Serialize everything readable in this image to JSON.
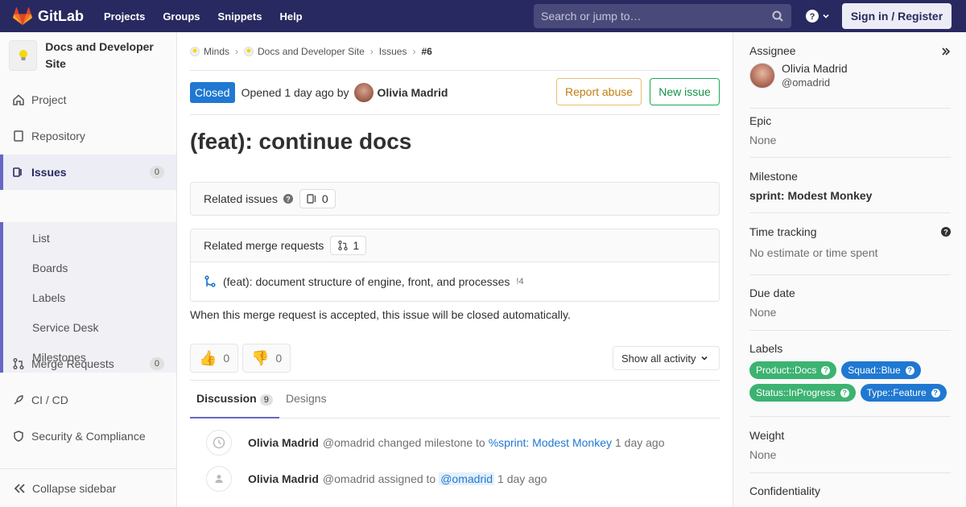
{
  "topbar": {
    "brand": "GitLab",
    "nav": [
      "Projects",
      "Groups",
      "Snippets",
      "Help"
    ],
    "search_placeholder": "Search or jump to…",
    "sign_in": "Sign in / Register"
  },
  "sidebar": {
    "project_name": "Docs and Developer Site",
    "items": [
      {
        "label": "Project",
        "icon": "home-icon"
      },
      {
        "label": "Repository",
        "icon": "document-icon"
      },
      {
        "label": "Issues",
        "icon": "issues-icon",
        "count": "0"
      },
      {
        "label": "Merge Requests",
        "icon": "merge-request-icon",
        "count": "0"
      },
      {
        "label": "CI / CD",
        "icon": "rocket-icon"
      },
      {
        "label": "Security & Compliance",
        "icon": "shield-icon"
      }
    ],
    "sub_items": [
      "List",
      "Boards",
      "Labels",
      "Service Desk",
      "Milestones"
    ],
    "collapse": "Collapse sidebar"
  },
  "breadcrumb": [
    "Minds",
    "Docs and Developer Site",
    "Issues",
    "#6"
  ],
  "issue": {
    "status": "Closed",
    "opened_prefix": "Opened",
    "opened_time": "1 day ago",
    "by": "by",
    "author": "Olivia Madrid",
    "report_abuse": "Report abuse",
    "new_issue": "New issue",
    "title": "(feat): continue docs",
    "related_issues_label": "Related issues",
    "related_issues_count": "0",
    "related_mr_label": "Related merge requests",
    "related_mr_count": "1",
    "mr_title": "(feat): document structure of engine, front, and processes",
    "mr_ref": "!4",
    "close_note": "When this merge request is accepted, this issue will be closed automatically.",
    "thumbs_up": "0",
    "thumbs_down": "0",
    "show_activity": "Show all activity",
    "tabs": {
      "discussion": "Discussion",
      "discussion_count": "9",
      "designs": "Designs"
    }
  },
  "activity": [
    {
      "name": "Olivia Madrid",
      "handle": "@omadrid",
      "action": "changed milestone to",
      "target": "%sprint: Modest Monkey",
      "time": "1 day ago"
    },
    {
      "name": "Olivia Madrid",
      "handle": "@omadrid",
      "action": "assigned to",
      "target": "@omadrid",
      "time": "1 day ago"
    }
  ],
  "right_sidebar": {
    "assignee_label": "Assignee",
    "assignee_name": "Olivia Madrid",
    "assignee_handle": "@omadrid",
    "epic_label": "Epic",
    "epic_value": "None",
    "milestone_label": "Milestone",
    "milestone_value": "sprint: Modest Monkey",
    "time_label": "Time tracking",
    "time_value": "No estimate or time spent",
    "due_label": "Due date",
    "due_value": "None",
    "labels_label": "Labels",
    "labels": [
      {
        "text": "Product::Docs",
        "color": "#3cb371"
      },
      {
        "text": "Squad::Blue",
        "color": "#1f78d1"
      },
      {
        "text": "Status::InProgress",
        "color": "#3cb371"
      },
      {
        "text": "Type::Feature",
        "color": "#1f78d1"
      }
    ],
    "weight_label": "Weight",
    "weight_value": "None",
    "confidentiality_label": "Confidentiality"
  }
}
